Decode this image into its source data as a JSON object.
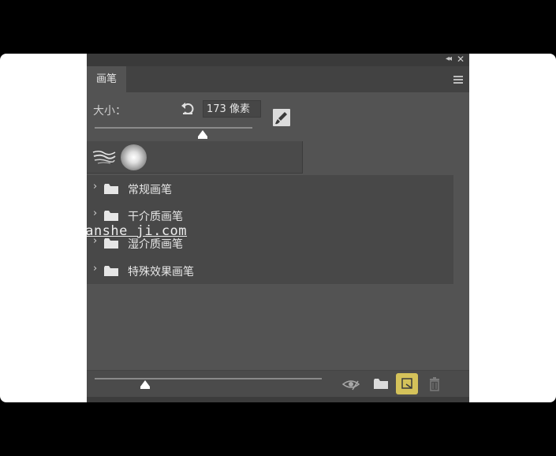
{
  "panel": {
    "tab_label": "画笔",
    "collapse_glyph": "◂◂",
    "close_glyph": "✕"
  },
  "size": {
    "label": "大小：",
    "value": "173 像素"
  },
  "brush_groups": [
    {
      "label": "常规画笔",
      "chevron": "›"
    },
    {
      "label": "干介质画笔",
      "chevron": "›"
    },
    {
      "label": "湿介质画笔",
      "chevron": "›"
    },
    {
      "label": "特殊效果画笔",
      "chevron": "›"
    }
  ],
  "watermark": "idianshe ji.com",
  "icons": {
    "reset": "reset-icon",
    "brush_settings": "brush-settings-icon",
    "visibility": "eye-icon",
    "folder": "folder-icon",
    "new_brush": "new-brush-icon",
    "delete": "trash-icon"
  },
  "colors": {
    "panel_bg": "#535353",
    "accent_new_button": "#d4c25a"
  }
}
